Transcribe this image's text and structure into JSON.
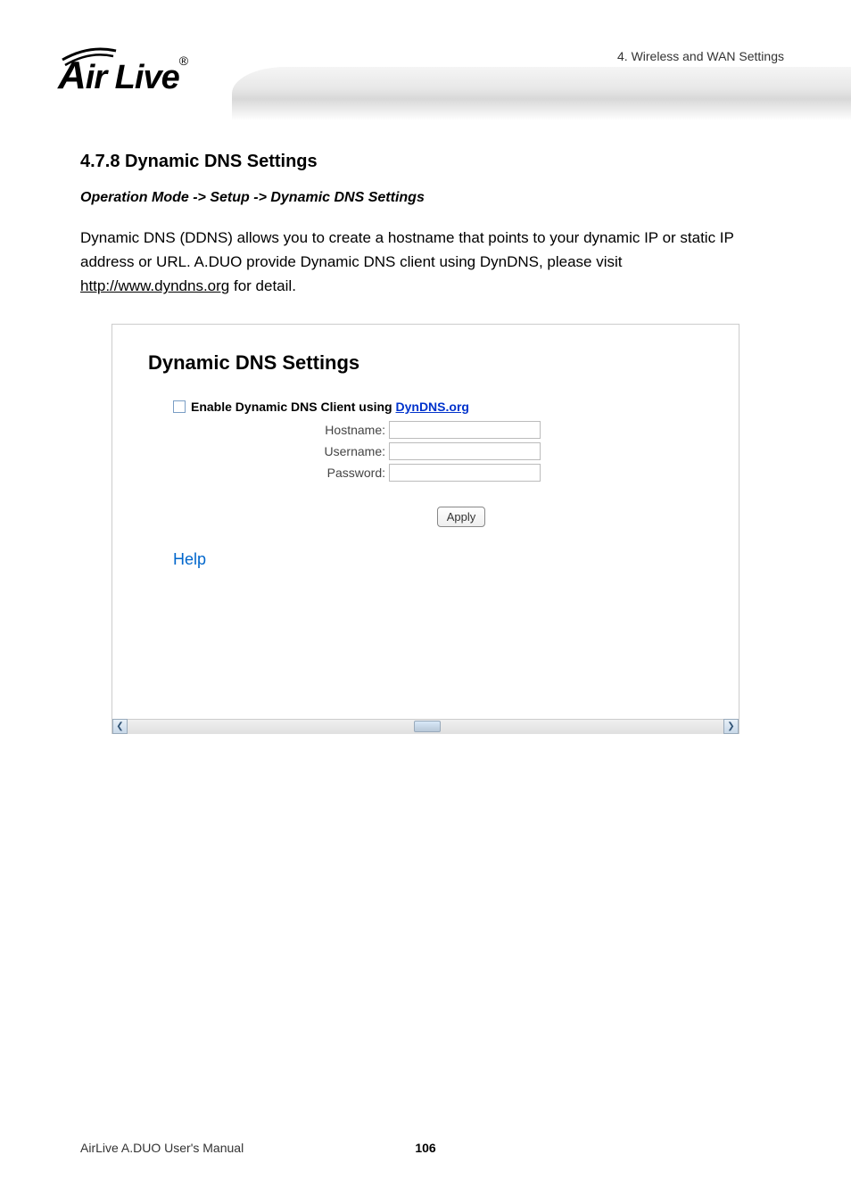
{
  "header": {
    "chapter_label": "4. Wireless and WAN Settings",
    "logo_text_main": "ir Live",
    "logo_a": "A",
    "logo_reg": "®"
  },
  "section": {
    "heading": "4.7.8 Dynamic DNS Settings",
    "breadcrumb": "Operation Mode -> Setup -> Dynamic DNS Settings",
    "body_text_1": "Dynamic DNS (DDNS) allows you to create a hostname that points to your dynamic IP or static IP address or URL. A.DUO provide Dynamic DNS client using DynDNS, please visit ",
    "body_link": "http://www.dyndns.org",
    "body_text_2": " for detail."
  },
  "panel": {
    "title": "Dynamic DNS Settings",
    "enable_label_prefix": "Enable Dynamic DNS Client using ",
    "enable_link": "DynDNS.org",
    "fields": {
      "hostname_label": "Hostname:",
      "username_label": "Username:",
      "password_label": "Password:"
    },
    "apply_label": "Apply",
    "help_label": "Help"
  },
  "footer": {
    "manual_name": "AirLive A.DUO User's Manual",
    "page_number": "106"
  }
}
